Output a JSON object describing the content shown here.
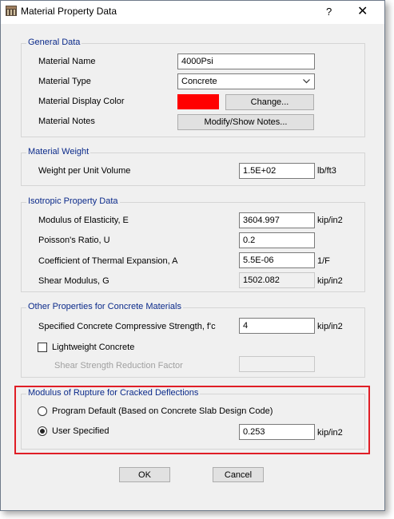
{
  "window": {
    "title": "Material Property Data",
    "help": "?",
    "close": "✕"
  },
  "general": {
    "title": "General Data",
    "name_label": "Material Name",
    "name_value": "4000Psi",
    "type_label": "Material Type",
    "type_value": "Concrete",
    "color_label": "Material Display Color",
    "color_value": "#ff0000",
    "change_btn": "Change...",
    "notes_label": "Material Notes",
    "notes_btn": "Modify/Show Notes..."
  },
  "weight": {
    "title": "Material Weight",
    "label": "Weight per Unit Volume",
    "value": "1.5E+02",
    "unit": "lb/ft3"
  },
  "isotropic": {
    "title": "Isotropic Property Data",
    "e_label": "Modulus of Elasticity,  E",
    "e_value": "3604.997",
    "e_unit": "kip/in2",
    "u_label": "Poisson's Ratio,  U",
    "u_value": "0.2",
    "a_label": "Coefficient of Thermal Expansion,  A",
    "a_value": "5.5E-06",
    "a_unit": "1/F",
    "g_label": "Shear Modulus,  G",
    "g_value": "1502.082",
    "g_unit": "kip/in2"
  },
  "concrete": {
    "title": "Other Properties for Concrete Materials",
    "fc_label": "Specified Concrete Compressive Strength, f'c",
    "fc_value": "4",
    "fc_unit": "kip/in2",
    "lw_label": "Lightweight Concrete",
    "lw_checked": false,
    "ssrf_label": "Shear Strength Reduction Factor",
    "ssrf_value": ""
  },
  "rupture": {
    "title": "Modulus of Rupture for Cracked Deflections",
    "default_label": "Program Default  (Based on Concrete Slab Design Code)",
    "user_label": "User Specified",
    "user_value": "0.253",
    "user_unit": "kip/in2",
    "selected": "User Specified"
  },
  "buttons": {
    "ok": "OK",
    "cancel": "Cancel"
  },
  "colors": {
    "highlight": "#e01e26",
    "group_title": "#0b2a8a"
  }
}
